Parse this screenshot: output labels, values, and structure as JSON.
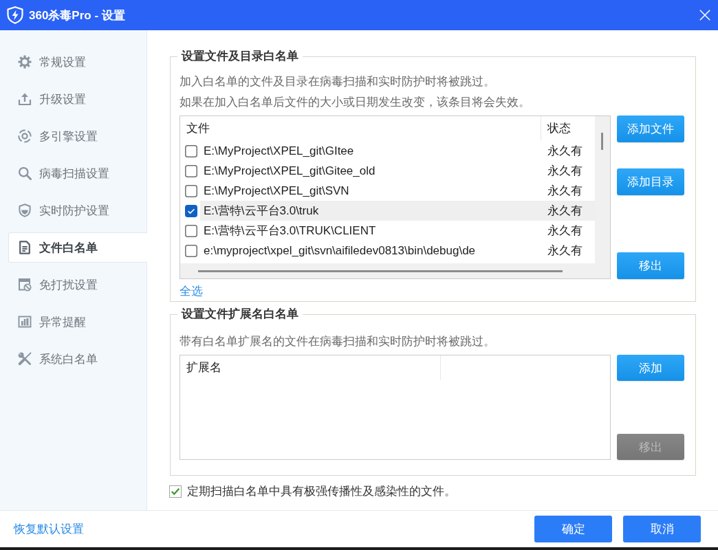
{
  "window": {
    "title": "360杀毒Pro - 设置"
  },
  "sidebar": {
    "items": [
      {
        "label": "常规设置",
        "selected": false
      },
      {
        "label": "升级设置",
        "selected": false
      },
      {
        "label": "多引擎设置",
        "selected": false
      },
      {
        "label": "病毒扫描设置",
        "selected": false
      },
      {
        "label": "实时防护设置",
        "selected": false
      },
      {
        "label": "文件白名单",
        "selected": true
      },
      {
        "label": "免打扰设置",
        "selected": false
      },
      {
        "label": "异常提醒",
        "selected": false
      },
      {
        "label": "系统白名单",
        "selected": false
      }
    ]
  },
  "file_whitelist": {
    "title": "设置文件及目录白名单",
    "description": [
      "加入白名单的文件及目录在病毒扫描和实时防护时将被跳过。",
      "如果在加入白名单后文件的大小或日期发生改变，该条目将会失效。"
    ],
    "table": {
      "columns": [
        "文件",
        "状态"
      ],
      "rows": [
        {
          "checked": false,
          "selected": false,
          "path": "E:\\MyProject\\XPEL_git\\GItee",
          "status": "永久有"
        },
        {
          "checked": false,
          "selected": false,
          "path": "E:\\MyProject\\XPEL_git\\Gitee_old",
          "status": "永久有"
        },
        {
          "checked": false,
          "selected": false,
          "path": "E:\\MyProject\\XPEL_git\\SVN",
          "status": "永久有"
        },
        {
          "checked": true,
          "selected": true,
          "path": "E:\\营特\\云平台3.0\\truk",
          "status": "永久有"
        },
        {
          "checked": false,
          "selected": false,
          "path": "E:\\营特\\云平台3.0\\TRUK\\CLIENT",
          "status": "永久有"
        },
        {
          "checked": false,
          "selected": false,
          "path": "e:\\myproject\\xpel_git\\svn\\aifiledev0813\\bin\\debug\\de",
          "status": "永久有"
        }
      ]
    },
    "buttons": [
      {
        "label": "添加文件",
        "disabled": false
      },
      {
        "label": "添加目录",
        "disabled": false
      },
      {
        "label": "移出",
        "disabled": false
      }
    ],
    "select_all": "全选"
  },
  "extension_whitelist": {
    "title": "设置文件扩展名白名单",
    "description": "带有白名单扩展名的文件在病毒扫描和实时防护时将被跳过。",
    "table": {
      "columns": [
        "扩展名"
      ]
    },
    "buttons": [
      {
        "label": "添加",
        "disabled": false
      },
      {
        "label": "移出",
        "disabled": true
      }
    ]
  },
  "periodic_scan": {
    "label": "定期扫描白名单中具有极强传播性及感染性的文件。",
    "checked": true
  },
  "footer": {
    "restore_link": "恢复默认设置",
    "buttons": [
      {
        "label": "确定"
      },
      {
        "label": "取消"
      }
    ]
  }
}
